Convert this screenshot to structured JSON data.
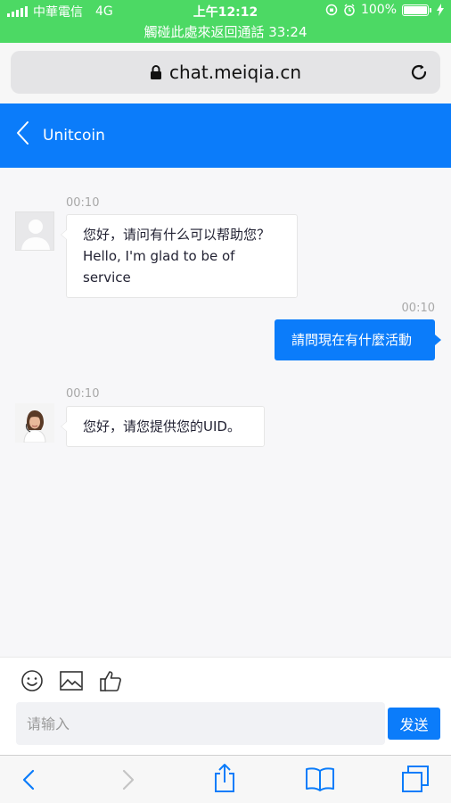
{
  "status_bar": {
    "carrier": "中華電信",
    "network": "4G",
    "time": "上午12:12",
    "battery": "100%",
    "call_banner": "觸碰此處來返回通話 33:24",
    "color": "#4cd964"
  },
  "browser": {
    "url": "chat.meiqia.cn",
    "icons": [
      "lock-icon",
      "reload-icon",
      "back-icon",
      "forward-icon",
      "share-icon",
      "bookmarks-icon",
      "tabs-icon"
    ]
  },
  "chat": {
    "title": "Unitcoin",
    "accent": "#0b7cfa",
    "messages": [
      {
        "time": "00:10",
        "from": "agent",
        "text_line1": "您好，请问有什么可以帮助您？",
        "text_line2": "Hello, I'm glad to be of service"
      },
      {
        "time": "00:10",
        "from": "user",
        "text": "請問現在有什麼活動"
      },
      {
        "time": "00:10",
        "from": "agent",
        "text": "您好，请您提供您的UID。"
      }
    ]
  },
  "composer": {
    "placeholder": "请输入",
    "send_label": "发送",
    "tools": [
      "emoji-icon",
      "image-icon",
      "thumbs-up-icon"
    ]
  }
}
